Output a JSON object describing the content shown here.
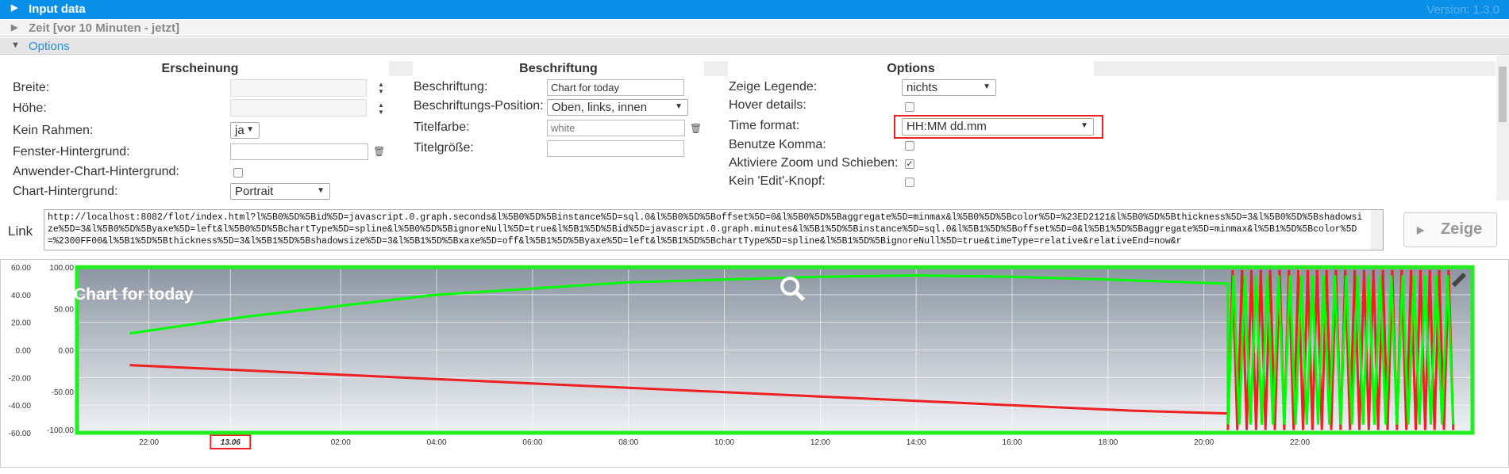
{
  "accordion": {
    "input_title": "Input data",
    "version": "Version: 1.3.0",
    "zeit_title": "Zeit [vor 10 Minuten - jetzt]",
    "options_title": "Options"
  },
  "erscheinung": {
    "heading": "Erscheinung",
    "breite_label": "Breite:",
    "breite_value": "",
    "hoehe_label": "Höhe:",
    "hoehe_value": "",
    "rahmen_label": "Kein Rahmen:",
    "rahmen_value": "ja",
    "fenster_label": "Fenster-Hintergrund:",
    "fenster_value": "",
    "anwender_label": "Anwender-Chart-Hintergrund:",
    "anwender_checked": false,
    "chart_bg_label": "Chart-Hintergrund:",
    "chart_bg_value": "Portrait"
  },
  "beschriftung": {
    "heading": "Beschriftung",
    "label": "Beschriftung:",
    "value": "Chart for today",
    "position_label": "Beschriftungs-Position:",
    "position_value": "Oben, links, innen",
    "titelfarbe_label": "Titelfarbe:",
    "titelfarbe_placeholder": "white",
    "titelgroesse_label": "Titelgröße:",
    "titelgroesse_value": ""
  },
  "options": {
    "heading": "Options",
    "legende_label": "Zeige Legende:",
    "legende_value": "nichts",
    "hover_label": "Hover details:",
    "hover_checked": false,
    "time_format_label": "Time format:",
    "time_format_value": "HH:MM dd.mm",
    "komma_label": "Benutze Komma:",
    "komma_checked": false,
    "zoom_label": "Aktiviere Zoom und Schieben:",
    "zoom_checked": true,
    "edit_label": "Kein 'Edit'-Knopf:",
    "edit_checked": false
  },
  "link": {
    "label": "Link",
    "url": "http://localhost:8082/flot/index.html?l%5B0%5D%5Bid%5D=javascript.0.graph.seconds&l%5B0%5D%5Binstance%5D=sql.0&l%5B0%5D%5Boffset%5D=0&l%5B0%5D%5Baggregate%5D=minmax&l%5B0%5D%5Bcolor%5D=%23ED2121&l%5B0%5D%5Bthickness%5D=3&l%5B0%5D%5Bshadowsize%5D=3&l%5B0%5D%5Byaxe%5D=left&l%5B0%5D%5BchartType%5D=spline&l%5B0%5D%5BignoreNull%5D=true&l%5B1%5D%5Bid%5D=javascript.0.graph.minutes&l%5B1%5D%5Binstance%5D=sql.0&l%5B1%5D%5Boffset%5D=0&l%5B1%5D%5Baggregate%5D=minmax&l%5B1%5D%5Bcolor%5D=%2300FF00&l%5B1%5D%5Bthickness%5D=3&l%5B1%5D%5Bshadowsize%5D=3&l%5B1%5D%5Bxaxe%5D=off&l%5B1%5D%5Byaxe%5D=left&l%5B1%5D%5BchartType%5D=spline&l%5B1%5D%5BignoreNull%5D=true&timeType=relative&relativeEnd=now&r",
    "show_button": "Zeige"
  },
  "chart_data": {
    "type": "line",
    "title": "Chart for today",
    "x_ticks": [
      "22:00",
      "13.06",
      "02:00",
      "04:00",
      "06:00",
      "08:00",
      "10:00",
      "12:00",
      "14:00",
      "16:00",
      "18:00",
      "20:00",
      "22:00"
    ],
    "y_left_ticks": [
      "60.00",
      "40.00",
      "20.00",
      "0.00",
      "-20.00",
      "-40.00",
      "-60.00"
    ],
    "y_right_ticks": [
      "100.00",
      "50.00",
      "0.00",
      "-50.00",
      "-100.00"
    ],
    "grid": true,
    "colors": {
      "seconds": "#ED2121",
      "minutes": "#00FF00",
      "frame": "#22ee22"
    },
    "series": [
      {
        "id": "javascript.0.graph.seconds",
        "color": "#ED2121",
        "axis": "left",
        "hours": [
          -2.4,
          18.5,
          20.5
        ],
        "values": [
          -11,
          -44,
          -46
        ],
        "oscillation": {
          "from_hour": 20.5,
          "to_hour": 25.2,
          "min": -58,
          "max": 58,
          "cycles": 24
        }
      },
      {
        "id": "javascript.0.graph.minutes",
        "color": "#00FF00",
        "axis": "left",
        "hours": [
          -2.4,
          0,
          4,
          8,
          12,
          14,
          16,
          18,
          20.5
        ],
        "values": [
          12,
          24,
          40,
          49,
          53,
          54,
          53,
          51,
          48
        ],
        "oscillation": {
          "from_hour": 20.5,
          "to_hour": 25.2,
          "min": -54,
          "max": 54,
          "cycles": 20
        }
      }
    ]
  }
}
